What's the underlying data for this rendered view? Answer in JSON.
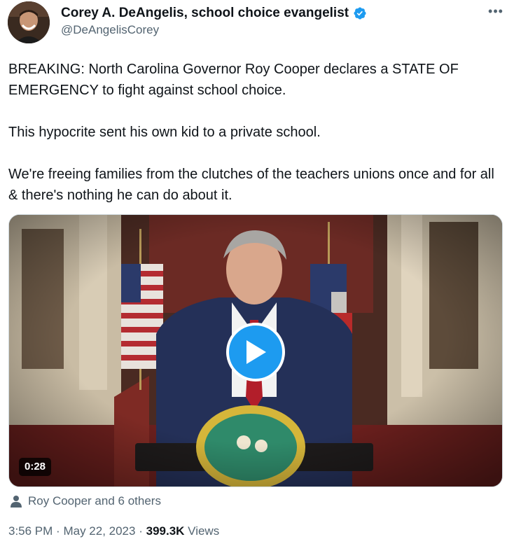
{
  "author": {
    "display_name": "Corey A. DeAngelis, school choice evangelist",
    "handle": "@DeAngelisCorey",
    "verified": true
  },
  "tweet": {
    "paragraphs": [
      "BREAKING: North Carolina Governor Roy Cooper declares a STATE OF EMERGENCY to fight against school choice.",
      "This hypocrite sent his own kid to a private school.",
      "We're freeing families from the clutches of the teachers unions once and for all & there's nothing he can do about it."
    ]
  },
  "media": {
    "duration": "0:28",
    "play_icon": "play-icon"
  },
  "tagged": {
    "text": "Roy Cooper and 6 others",
    "icon": "person-icon"
  },
  "meta": {
    "time": "3:56 PM",
    "separator": "·",
    "date": "May 22, 2023",
    "views_count": "399.3K",
    "views_label": "Views"
  },
  "colors": {
    "accent": "#1d9bf0",
    "secondary_text": "#536471",
    "primary_text": "#0f1419"
  }
}
